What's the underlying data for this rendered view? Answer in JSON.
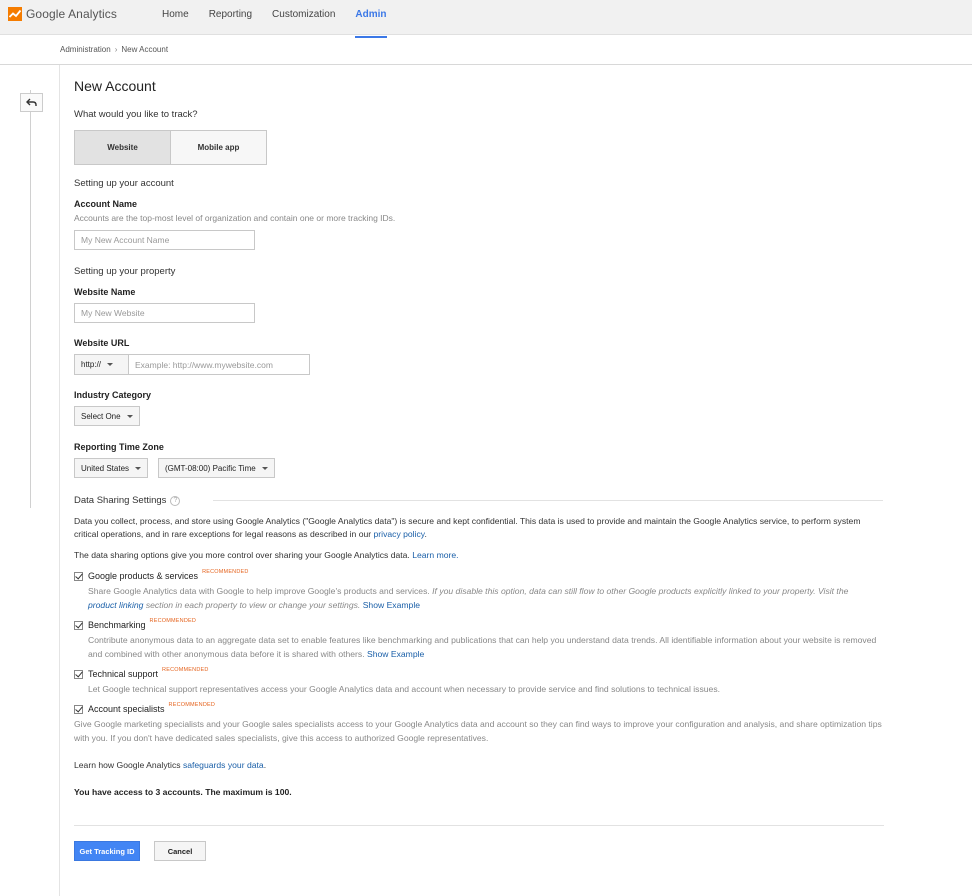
{
  "app": {
    "name": "Google Analytics"
  },
  "nav": [
    "Home",
    "Reporting",
    "Customization",
    "Admin"
  ],
  "breadcrumb": {
    "root": "Administration",
    "sep": "›",
    "current": "New Account"
  },
  "page": {
    "title": "New Account",
    "track_question": "What would you like to track?",
    "track_options": [
      "Website",
      "Mobile app"
    ],
    "account_section": "Setting up your account",
    "account_name_label": "Account Name",
    "account_name_help": "Accounts are the top-most level of organization and contain one or more tracking IDs.",
    "account_name_placeholder": "My New Account Name",
    "property_section": "Setting up your property",
    "website_name_label": "Website Name",
    "website_name_placeholder": "My New Website",
    "website_url_label": "Website URL",
    "protocol": "http://",
    "website_url_placeholder": "Example: http://www.mywebsite.com",
    "industry_label": "Industry Category",
    "industry_value": "Select One",
    "timezone_label": "Reporting Time Zone",
    "country_value": "United States",
    "timezone_value": "(GMT-08:00) Pacific Time"
  },
  "sharing": {
    "title": "Data Sharing Settings",
    "help_icon": "?",
    "intro": "Data you collect, process, and store using Google Analytics (\"Google Analytics data\") is secure and kept confidential. This data is used to provide and maintain the Google Analytics service, to perform system critical operations, and in rare exceptions for legal reasons as described in our",
    "privacy_link": "privacy policy",
    "intro_end": ".",
    "options_text": "The data sharing options give you more control over sharing your Google Analytics data.",
    "learn_more": "Learn more.",
    "recommended": "RECOMMENDED",
    "items": [
      {
        "label": "Google products & services",
        "desc_a": "Share Google Analytics data with Google to help improve Google's products and services.",
        "desc_italic": "If you disable this option, data can still flow to other Google products explicitly linked to your property. Visit the",
        "desc_link": "product linking",
        "desc_italic2": "section in each property to view or change your settings.",
        "show_example": "Show Example"
      },
      {
        "label": "Benchmarking",
        "desc": "Contribute anonymous data to an aggregate data set to enable features like benchmarking and publications that can help you understand data trends. All identifiable information about your website is removed and combined with other anonymous data before it is shared with others.",
        "show_example": "Show Example"
      },
      {
        "label": "Technical support",
        "desc": "Let Google technical support representatives access your Google Analytics data and account when necessary to provide service and find solutions to technical issues."
      },
      {
        "label": "Account specialists",
        "desc": "Give Google marketing specialists and your Google sales specialists access to your Google Analytics data and account so they can find ways to improve your configuration and analysis, and share optimization tips with you. If you don't have dedicated sales specialists, give this access to authorized Google representatives."
      }
    ],
    "safeguards_text": "Learn how Google Analytics",
    "safeguards_link": "safeguards your data",
    "safeguards_end": ".",
    "access_text": "You have access to 3 accounts. The maximum is 100."
  },
  "buttons": {
    "primary": "Get Tracking ID",
    "cancel": "Cancel"
  },
  "colors": {
    "accent": "#3b78e7",
    "primary_button": "#4285f4",
    "recommended": "#e5641f",
    "link": "#1a5fa8",
    "logo": "#f57c00"
  },
  "icons": {
    "back": "back-arrow-icon",
    "logo": "google-analytics-logo-icon"
  }
}
